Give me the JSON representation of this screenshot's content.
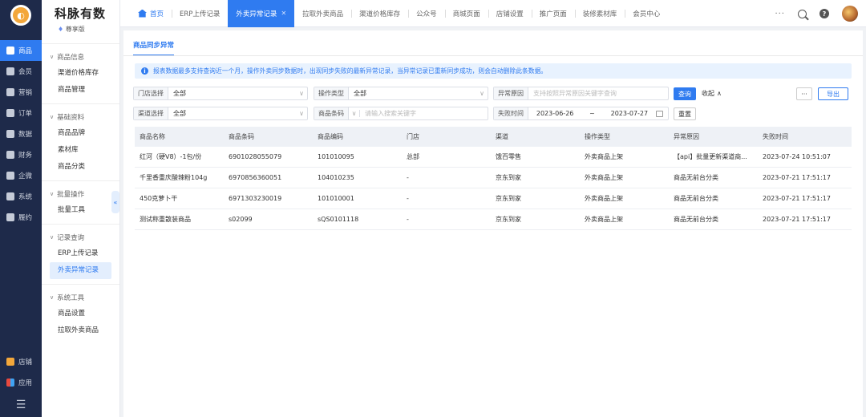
{
  "rail": {
    "items": [
      {
        "label": "商品",
        "icon": "product-icon",
        "active": true
      },
      {
        "label": "会员",
        "icon": "member-icon"
      },
      {
        "label": "营销",
        "icon": "marketing-icon"
      },
      {
        "label": "订单",
        "icon": "order-icon"
      },
      {
        "label": "数据",
        "icon": "data-icon"
      },
      {
        "label": "财务",
        "icon": "finance-icon"
      },
      {
        "label": "企微",
        "icon": "wecom-icon"
      },
      {
        "label": "系统",
        "icon": "gear-icon"
      },
      {
        "label": "履约",
        "icon": "fulfillment-icon"
      }
    ],
    "bottom": [
      {
        "label": "店铺",
        "icon": "store-icon"
      },
      {
        "label": "应用",
        "icon": "apps-icon"
      }
    ]
  },
  "sidebar": {
    "brand": "科脉有数",
    "edition": "尊享版",
    "groups": [
      {
        "title": "商品信息",
        "items": [
          "渠道价格库存",
          "商品管理"
        ]
      },
      {
        "title": "基础资料",
        "items": [
          "商品品牌",
          "素材库",
          "商品分类"
        ]
      },
      {
        "title": "批量操作",
        "items": [
          "批量工具"
        ]
      },
      {
        "title": "记录查询",
        "items": [
          "ERP上传记录",
          "外卖异常记录"
        ]
      },
      {
        "title": "系统工具",
        "items": [
          "商品设置",
          "拉取外卖商品"
        ]
      }
    ]
  },
  "tabs": [
    "首页",
    "ERP上传记录",
    "外卖异常记录",
    "拉取外卖商品",
    "渠道价格库存",
    "公众号",
    "商城页面",
    "店铺设置",
    "推广页面",
    "装修素材库",
    "会员中心"
  ],
  "page": {
    "subtab": "商品同步异常",
    "notice": "报表数据最多支持查询近一个月，操作外卖同步数据时，出现同步失败的最新异常记录，当异常记录已重新同步成功，则会自动删除此条数据。",
    "filters": {
      "store_label": "门店选择",
      "store_value": "全部",
      "optype_label": "操作类型",
      "optype_value": "全部",
      "reason_label": "异常原因",
      "reason_placeholder": "支持按照异常原因关键字查询",
      "channel_label": "渠道选择",
      "channel_value": "全部",
      "barcode_label": "商品条码",
      "barcode_placeholder": "请输入搜索关键字",
      "time_label": "失败时间",
      "date_from": "2023-06-26",
      "date_sep": "~",
      "date_to": "2023-07-27"
    },
    "buttons": {
      "query": "查询",
      "collapse": "收起",
      "reset": "重置",
      "more": "···",
      "export": "导出"
    }
  },
  "table": {
    "headers": [
      "商品名称",
      "商品条码",
      "商品编码",
      "门店",
      "渠道",
      "操作类型",
      "异常原因",
      "失败时间"
    ],
    "rows": [
      [
        "红河（硬V8）-1包/份",
        "6901028055079",
        "101010095",
        "总部",
        "饿百零售",
        "外卖商品上架",
        "【api】批量更新渠道商...",
        "2023-07-24 10:51:07"
      ],
      [
        "千里香重庆酸辣粉104g",
        "6970856360051",
        "104010235",
        "-",
        "京东到家",
        "外卖商品上架",
        "商品无前台分类",
        "2023-07-21 17:51:17"
      ],
      [
        "450克萝卜干",
        "6971303230019",
        "101010001",
        "-",
        "京东到家",
        "外卖商品上架",
        "商品无前台分类",
        "2023-07-21 17:51:17"
      ],
      [
        "测试称重散装商品",
        "s02099",
        "sQS0101118",
        "-",
        "京东到家",
        "外卖商品上架",
        "商品无前台分类",
        "2023-07-21 17:51:17"
      ]
    ]
  }
}
